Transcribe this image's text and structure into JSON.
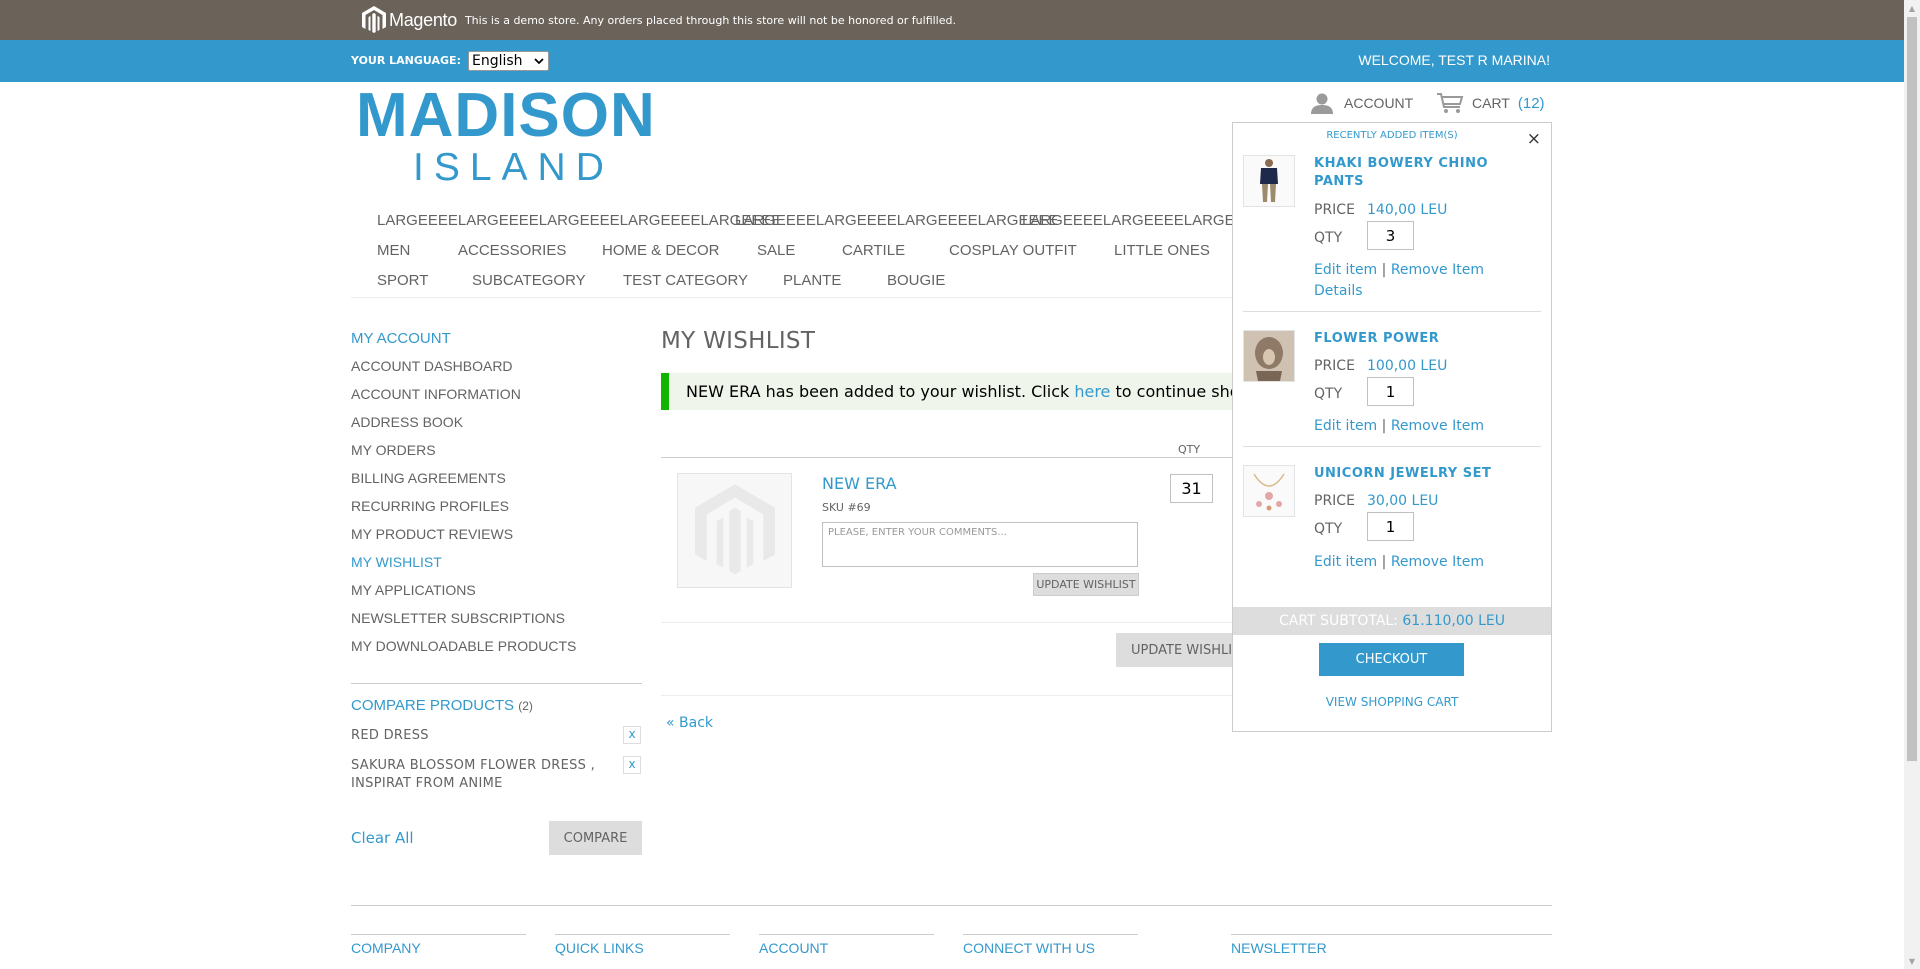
{
  "demo_notice": {
    "logo_text": "Magento",
    "text": "This is a demo store. Any orders placed through this store will not be honored or fulfilled."
  },
  "lang_bar": {
    "label": "YOUR LANGUAGE:",
    "selected": "English",
    "welcome": "WELCOME, TEST R MARINA!"
  },
  "header": {
    "logo_top": "MADISON",
    "logo_bottom": "ISLAND",
    "account_label": "ACCOUNT",
    "cart_label": "CART",
    "cart_count": "(12)"
  },
  "nav": {
    "row1": [
      "LARGEEEELARGEEEELARGEEEELARGEEEELARGEEEE",
      "LARGEEEELARGEEEELARGEEEELARGEEEE",
      "LARGEEEELARGEEEELARGEEEE"
    ],
    "row2": [
      "MEN",
      "ACCESSORIES",
      "HOME & DECOR",
      "SALE",
      "CARTILE",
      "COSPLAY OUTFIT",
      "LITTLE ONES"
    ],
    "row3": [
      "SPORT",
      "SUBCATEGORY",
      "TEST CATEGORY",
      "PLANTE",
      "BOUGIE"
    ]
  },
  "sidebar": {
    "title": "MY ACCOUNT",
    "items": [
      {
        "label": "ACCOUNT DASHBOARD"
      },
      {
        "label": "ACCOUNT INFORMATION"
      },
      {
        "label": "ADDRESS BOOK"
      },
      {
        "label": "MY ORDERS"
      },
      {
        "label": "BILLING AGREEMENTS"
      },
      {
        "label": "RECURRING PROFILES"
      },
      {
        "label": "MY PRODUCT REVIEWS"
      },
      {
        "label": "MY WISHLIST"
      },
      {
        "label": "MY APPLICATIONS"
      },
      {
        "label": "NEWSLETTER SUBSCRIPTIONS"
      },
      {
        "label": "MY DOWNLOADABLE PRODUCTS"
      }
    ],
    "active_index": 7
  },
  "compare": {
    "title": "COMPARE PRODUCTS",
    "count": "(2)",
    "items": [
      {
        "name": "RED DRESS",
        "remove": "x"
      },
      {
        "name": "SAKURA BLOSSOM FLOWER DRESS , INSPIRAT FROM ANIME",
        "remove": "x"
      }
    ],
    "clear_all": "Clear All",
    "compare_button": "COMPARE"
  },
  "main": {
    "title": "MY WISHLIST",
    "message_prefix": "NEW ERA has been added to your wishlist. Click ",
    "message_link": "here",
    "message_suffix": " to continue shopping.",
    "qty_header": "QTY",
    "item": {
      "name": "NEW ERA",
      "sku": "SKU #69",
      "comment_placeholder": "PLEASE, ENTER YOUR COMMENTS...",
      "update_small": "UPDATE WISHLIST",
      "qty": "31"
    },
    "update_wishlist": "UPDATE WISHLIST",
    "back": "« Back"
  },
  "minicart": {
    "title": "RECENTLY ADDED ITEM(S)",
    "close": "×",
    "price_label": "PRICE",
    "qty_label": "QTY",
    "edit_label": "Edit item",
    "remove_label": "Remove Item",
    "separator": "|",
    "details_label": "Details",
    "items": [
      {
        "name": "KHAKI BOWERY CHINO PANTS",
        "price": "140,00 LEU",
        "qty": "3"
      },
      {
        "name": "FLOWER POWER",
        "price": "100,00 LEU",
        "qty": "1"
      },
      {
        "name": "UNICORN JEWELRY SET",
        "price": "30,00 LEU",
        "qty": "1"
      }
    ],
    "subtotal_label": "CART SUBTOTAL:",
    "subtotal_value": "61.110,00 LEU",
    "checkout": "CHECKOUT",
    "view_cart": "VIEW SHOPPING CART"
  },
  "footer": {
    "columns": [
      "COMPANY",
      "QUICK LINKS",
      "ACCOUNT",
      "CONNECT WITH US",
      "NEWSLETTER"
    ]
  },
  "colors": {
    "accent": "#3399cc",
    "demo_bar": "#6b635a",
    "success_border": "#11b400",
    "text": "#636363"
  }
}
